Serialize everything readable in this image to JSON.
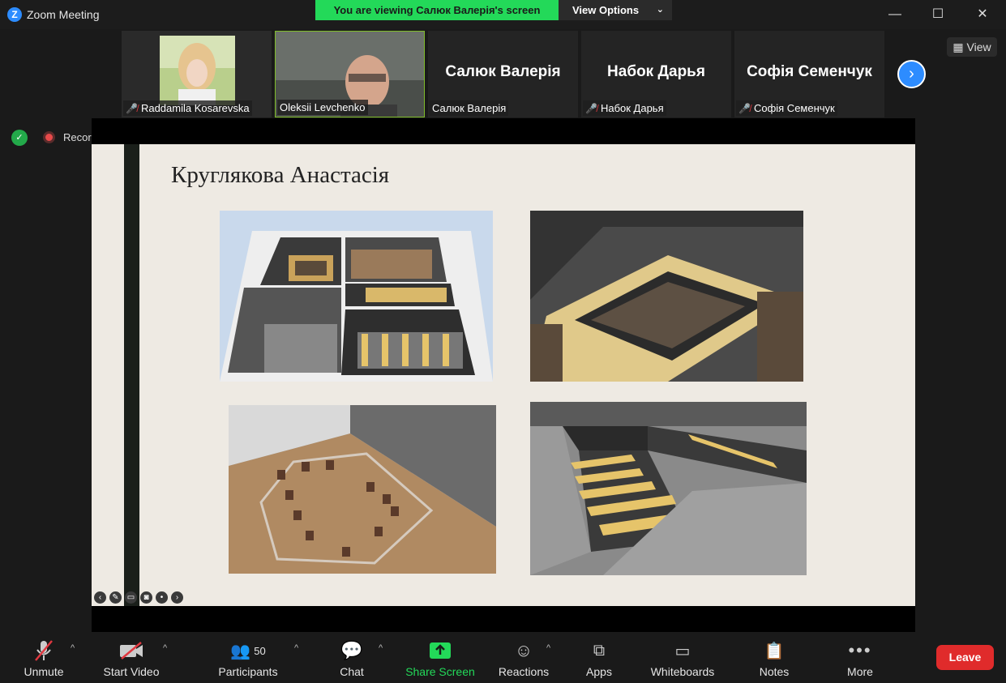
{
  "window": {
    "title": "Zoom Meeting",
    "logo_letter": "Z",
    "viewing_banner": "You are viewing Салюк Валерія's screen",
    "view_options": "View Options",
    "minimize": "—",
    "maximize": "☐",
    "close": "✕"
  },
  "participants": [
    {
      "name": "Raddamila Kosarevska",
      "muted": true,
      "video": true
    },
    {
      "name": "Oleksii Levchenko",
      "muted": false,
      "video": true
    },
    {
      "name": "Салюк Валерія",
      "display": "Салюк Валерія",
      "muted": false,
      "video": false
    },
    {
      "name": "Набок Дарья",
      "display": "Набок Дарья",
      "muted": true,
      "video": false
    },
    {
      "name": "Софія Семенчук",
      "display": "Софія Семенчук",
      "muted": true,
      "video": false
    }
  ],
  "view_button": "View",
  "recording": {
    "label": "Recording"
  },
  "slide": {
    "title": "Круглякова Анастасія"
  },
  "toolbar": {
    "unmute": "Unmute",
    "start_video": "Start Video",
    "participants": "Participants",
    "participants_count": "50",
    "chat": "Chat",
    "share_screen": "Share Screen",
    "reactions": "Reactions",
    "apps": "Apps",
    "whiteboards": "Whiteboards",
    "notes": "Notes",
    "more": "More",
    "leave": "Leave"
  },
  "colors": {
    "accent": "#2d8cff",
    "share_green": "#23d959",
    "leave_red": "#e02b2b",
    "active_speaker": "#7fbd2a"
  }
}
